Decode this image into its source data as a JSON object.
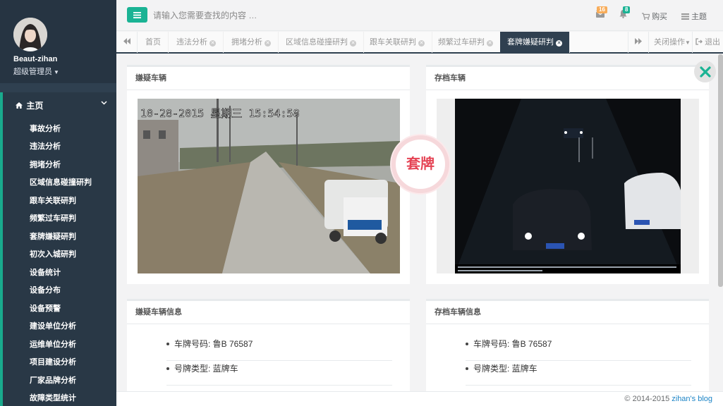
{
  "sidebar": {
    "profile": {
      "name": "Beaut-zihan",
      "role": "超级管理员"
    },
    "nav_header": "主页",
    "items": [
      "事故分析",
      "违法分析",
      "拥堵分析",
      "区域信息碰撞研判",
      "跟车关联研判",
      "频繁过车研判",
      "套牌嫌疑研判",
      "初次入城研判",
      "设备统计",
      "设备分布",
      "设备预警",
      "建设单位分析",
      "运维单位分析",
      "项目建设分析",
      "厂家品牌分析",
      "故障类型统计"
    ]
  },
  "topbar": {
    "search_placeholder": "请输入您需要查找的内容 …",
    "mail_badge": "16",
    "bell_badge": "8",
    "buy_label": "购买",
    "theme_label": "主题"
  },
  "tabs": {
    "items": [
      "首页",
      "违法分析",
      "拥堵分析",
      "区域信息碰撞研判",
      "跟车关联研判",
      "频繁过车研判",
      "套牌嫌疑研判"
    ],
    "close_ops": "关闭操作",
    "logout": "退出"
  },
  "content": {
    "suspect_title": "嫌疑车辆",
    "archive_title": "存档车辆",
    "suspect_info_title": "嫌疑车辆信息",
    "archive_info_title": "存档车辆信息",
    "photo_timestamp": "10-28-2015 星期三 15:54:58",
    "stamp_text": "套牌",
    "suspect_info": [
      "车牌号码: 鲁B 76587",
      "号牌类型: 蓝牌车"
    ],
    "archive_info": [
      "车牌号码: 鲁B 76587",
      "号牌类型: 蓝牌车"
    ]
  },
  "footer": {
    "copyright": "© 2014-2015",
    "blog_link": "zihan's blog"
  }
}
